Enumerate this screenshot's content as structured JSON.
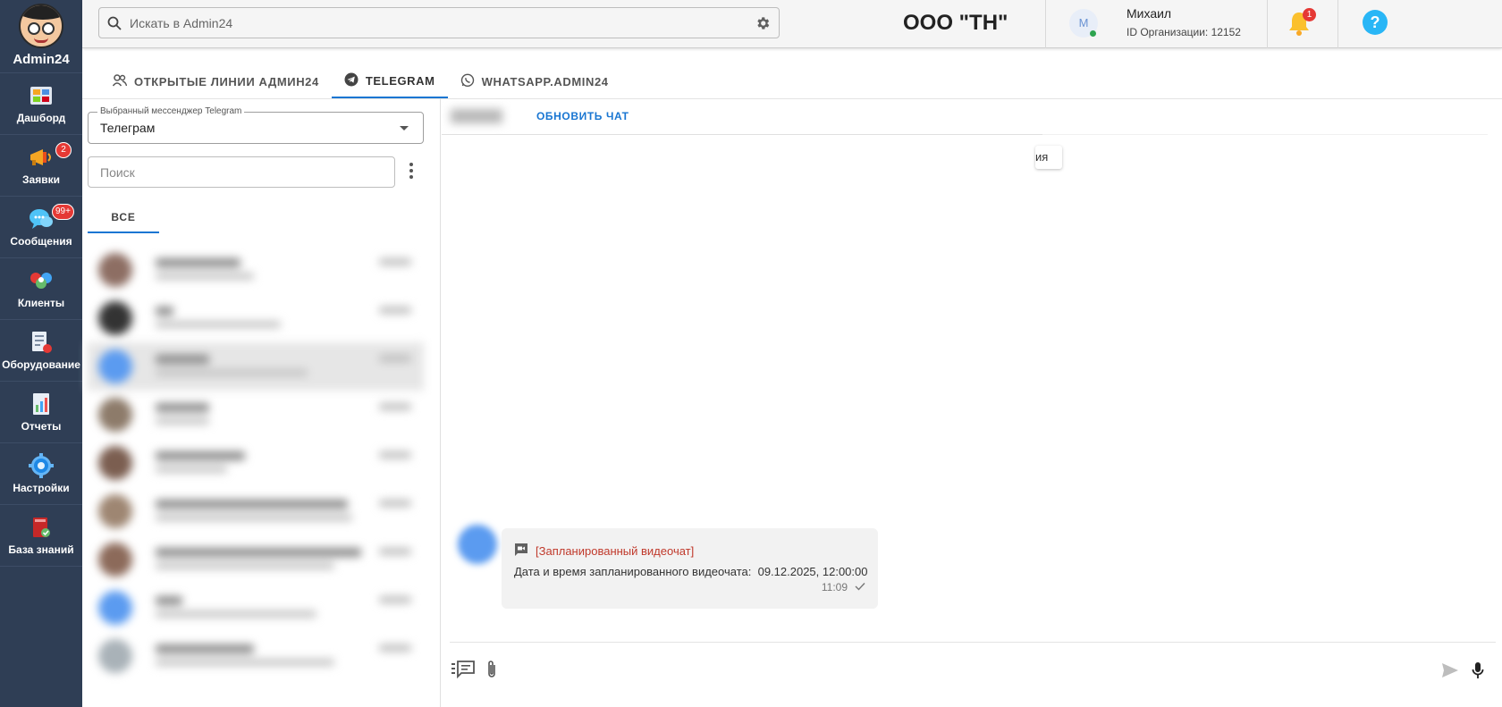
{
  "app": {
    "brand_name": "Admin24"
  },
  "sidebar": {
    "items": [
      {
        "label": "Дашборд",
        "icon": "dashboard-icon",
        "badge": null
      },
      {
        "label": "Заявки",
        "icon": "megaphone-icon",
        "badge": "2"
      },
      {
        "label": "Сообщения",
        "icon": "chat-bubbles-icon",
        "badge": "99+"
      },
      {
        "label": "Клиенты",
        "icon": "clients-icon",
        "badge": null
      },
      {
        "label": "Оборудование",
        "icon": "equipment-icon",
        "badge": null
      },
      {
        "label": "Отчеты",
        "icon": "reports-icon",
        "badge": null
      },
      {
        "label": "Настройки",
        "icon": "settings-gear-icon",
        "badge": null
      },
      {
        "label": "База знаний",
        "icon": "knowledge-book-icon",
        "badge": null
      }
    ]
  },
  "topbar": {
    "search_placeholder": "Искать в Admin24",
    "org_title": "ООО \"ТН\"",
    "user": {
      "initial": "М",
      "name": "Михаил",
      "org_id": "ID Организации: 12152"
    },
    "notifications_count": "1",
    "help_label": "?"
  },
  "tabs": [
    {
      "label": "ОТКРЫТЫЕ ЛИНИИ АДМИН24",
      "icon": "people-icon",
      "active": false
    },
    {
      "label": "TELEGRAM",
      "icon": "telegram-icon",
      "active": true
    },
    {
      "label": "WHATSAPP.ADMIN24",
      "icon": "whatsapp-icon",
      "active": false
    }
  ],
  "left_panel": {
    "messenger_legend": "Выбранный мессенджер Telegram",
    "messenger_value": "Телеграм",
    "search_placeholder": "Поиск",
    "filter_tab": "ВСЕ"
  },
  "chat": {
    "refresh_label": "ОБНОВИТЬ ЧАТ",
    "date_chip": "ия",
    "message": {
      "title": "[Запланированный видеочат]",
      "text_label": "Дата и время запланированного видеочата:",
      "text_value": "09.12.2025, 12:00:00",
      "time": "11:09"
    }
  },
  "colors": {
    "sidebar_bg": "#2f3e55",
    "accent": "#1976d2",
    "badge": "#e53935",
    "video_title": "#c0392b"
  }
}
